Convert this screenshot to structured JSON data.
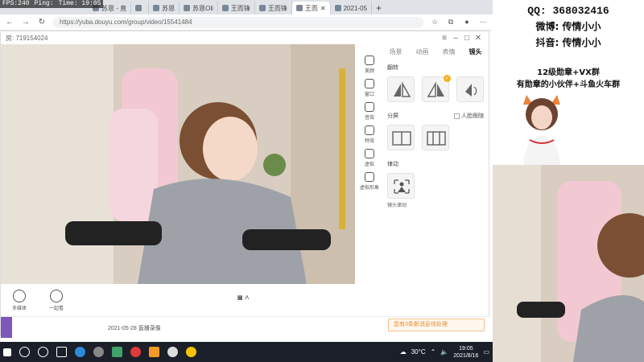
{
  "perf": {
    "fps": "FPS:240",
    "ping": "Ping:",
    "time": "Time: 19:05"
  },
  "tabs": [
    {
      "label": "苏恩 - 直"
    },
    {
      "label": ""
    },
    {
      "label": "苏恩"
    },
    {
      "label": "苏恩Oli"
    },
    {
      "label": "王而锋"
    },
    {
      "label": "王而锋"
    },
    {
      "label": "王而"
    },
    {
      "label": "2021-05"
    }
  ],
  "browser": {
    "url": "https://yuba.douyu.com/group/video/15541484"
  },
  "dialog": {
    "room": "房: 719154024"
  },
  "rail": [
    {
      "label": "美颜",
      "icon": "beauty-icon"
    },
    {
      "label": "窗口",
      "icon": "window-icon"
    },
    {
      "label": "音效",
      "icon": "sound-icon"
    },
    {
      "label": "特效",
      "icon": "effects-icon"
    },
    {
      "label": "虚拟",
      "icon": "virtual-icon"
    },
    {
      "label": "虚拟形象",
      "icon": "avatar-icon"
    }
  ],
  "panel": {
    "tabs": [
      "场景",
      "动画",
      "表情",
      "镜头"
    ],
    "flip": "翻转",
    "split": "分屏",
    "face_follow": "人脸跟随",
    "shake": "律动",
    "shake_label": "镜头律动"
  },
  "tools": [
    {
      "label": "多媒体",
      "icon": "media-icon"
    },
    {
      "label": "一起看",
      "icon": "watch-together-icon"
    }
  ],
  "record": {
    "date": "2021-05-28 直播录像",
    "notice": "您有3条新消息待处理"
  },
  "taskbar": {
    "weather": "30°C",
    "time": "19:05",
    "date": "2021/8/16"
  },
  "info": {
    "qq": "QQ: 368032416",
    "weibo": "微博: 传情小小",
    "douyin": "抖音: 传情小小",
    "group": "12级勋章+VX群",
    "group2": "有勋章的小伙伴+斗鱼火车群"
  },
  "colors": {
    "accent": "#f5b01b",
    "taskbar": "#1b1f29",
    "notice": "#e58b2a",
    "purple": "#7d58b8"
  }
}
